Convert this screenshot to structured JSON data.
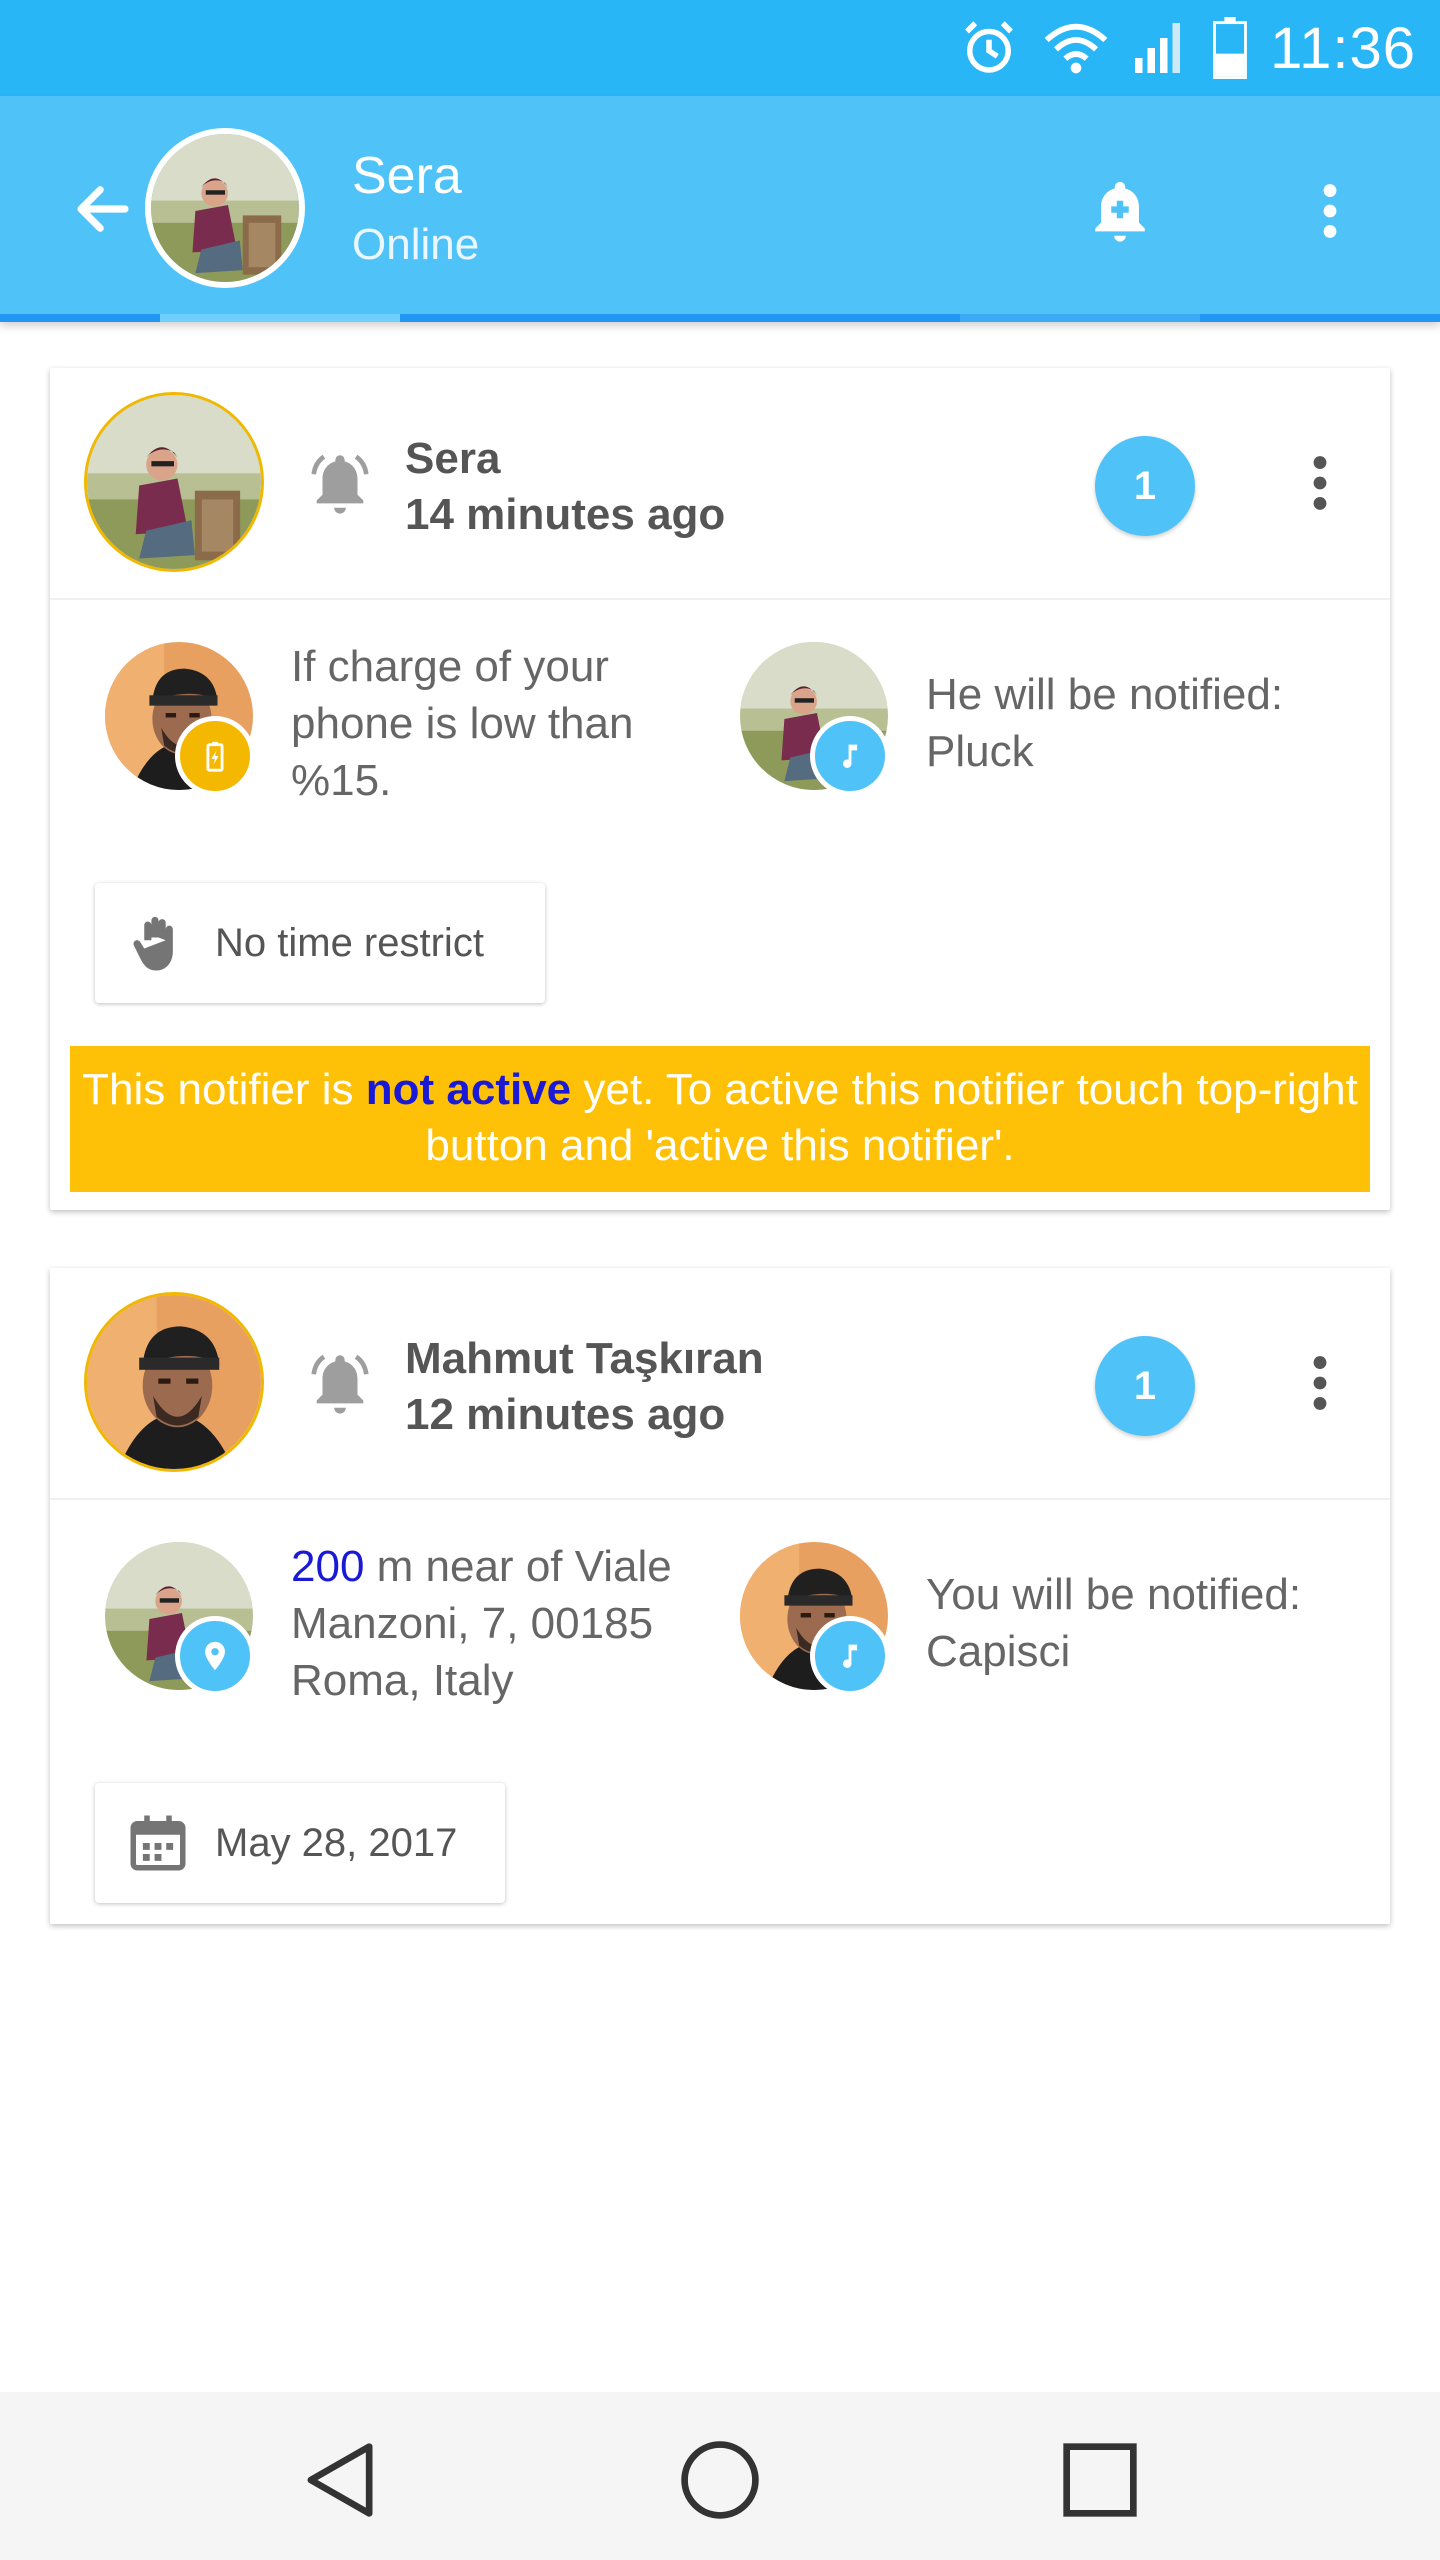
{
  "status_bar": {
    "time": "11:36",
    "icons": [
      "alarm-icon",
      "wifi-icon",
      "signal-icon",
      "battery-icon"
    ]
  },
  "app_bar": {
    "contact_name": "Sera",
    "presence": "Online",
    "actions": [
      "back-arrow-icon",
      "bell-add-icon",
      "more-vert-icon"
    ]
  },
  "colors": {
    "status_bar": "#29b6f6",
    "app_bar": "#4fc3f7",
    "badge_blue": "#4fc3f7",
    "battery_badge": "#f5b800",
    "warning": "#ffc107",
    "emphasis_blue": "#1a1ad6"
  },
  "cards": [
    {
      "owner": "Sera",
      "time": "14 minutes ago",
      "count": "1",
      "trigger_text": "If charge of your phone is low than %15.",
      "trigger_icon": "battery-charging-icon",
      "action_text": "He will be notified: Pluck",
      "action_icon": "music-note-icon",
      "restriction_label": "No time restrict",
      "restriction_icon": "hand-icon",
      "warning": {
        "before": "This notifier is ",
        "emphasis": "not active",
        "after": " yet. To active this notifier touch top-right button and 'active this notifier'."
      }
    },
    {
      "owner": "Mahmut Taşkıran",
      "time": "12 minutes ago",
      "count": "1",
      "trigger_distance": "200",
      "trigger_text": " m near of Viale Manzoni, 7, 00185 Roma, Italy",
      "trigger_icon": "location-pin-icon",
      "action_text": "You will be notified: Capisci",
      "action_icon": "music-note-icon",
      "restriction_label": "May 28, 2017",
      "restriction_icon": "calendar-icon"
    }
  ],
  "nav_bar": [
    "back-triangle-icon",
    "home-circle-icon",
    "recents-square-icon"
  ]
}
